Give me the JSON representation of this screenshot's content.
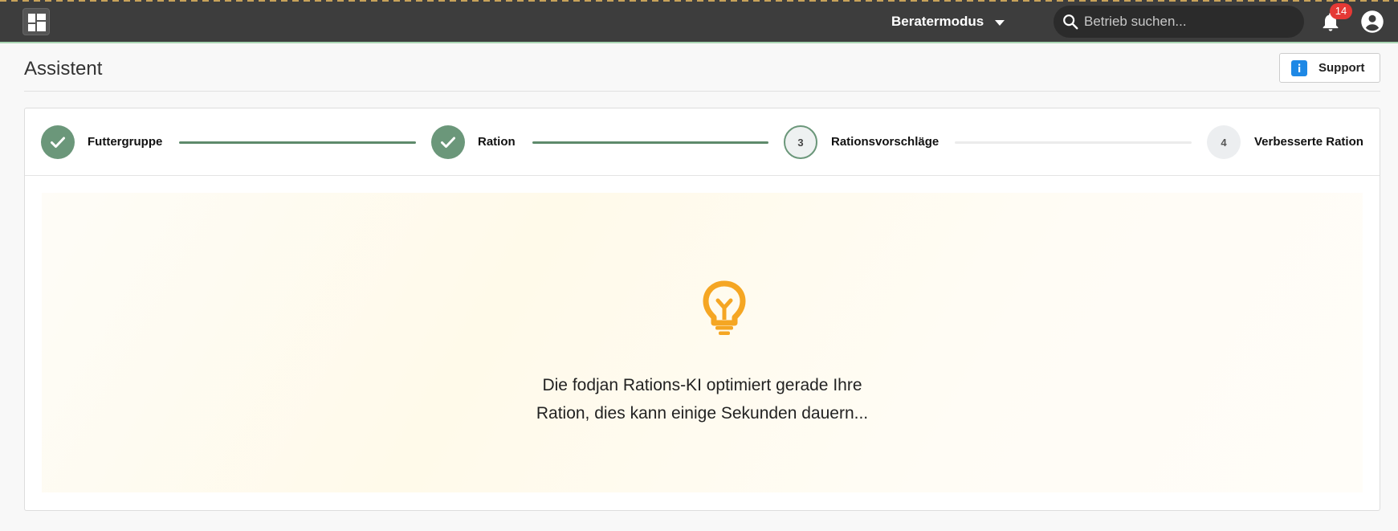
{
  "topbar": {
    "logo_icon": "dashboard-grid-icon",
    "mode_label": "Beratermodus",
    "search_placeholder": "Betrieb suchen...",
    "notification_count": "14",
    "accent_color": "#a9d6b3"
  },
  "header": {
    "title": "Assistent",
    "support_label": "Support"
  },
  "stepper": {
    "steps": [
      {
        "number": "1",
        "label": "Futtergruppe",
        "state": "done"
      },
      {
        "number": "2",
        "label": "Ration",
        "state": "done"
      },
      {
        "number": "3",
        "label": "Rationsvorschläge",
        "state": "active"
      },
      {
        "number": "4",
        "label": "Verbesserte Ration",
        "state": "pending"
      }
    ],
    "done_color": "#6b977a"
  },
  "loading": {
    "icon": "lightbulb-icon",
    "icon_color": "#f5a623",
    "line1": "Die fodjan Rations-KI optimiert gerade Ihre",
    "line2": "Ration, dies kann einige Sekunden dauern..."
  }
}
